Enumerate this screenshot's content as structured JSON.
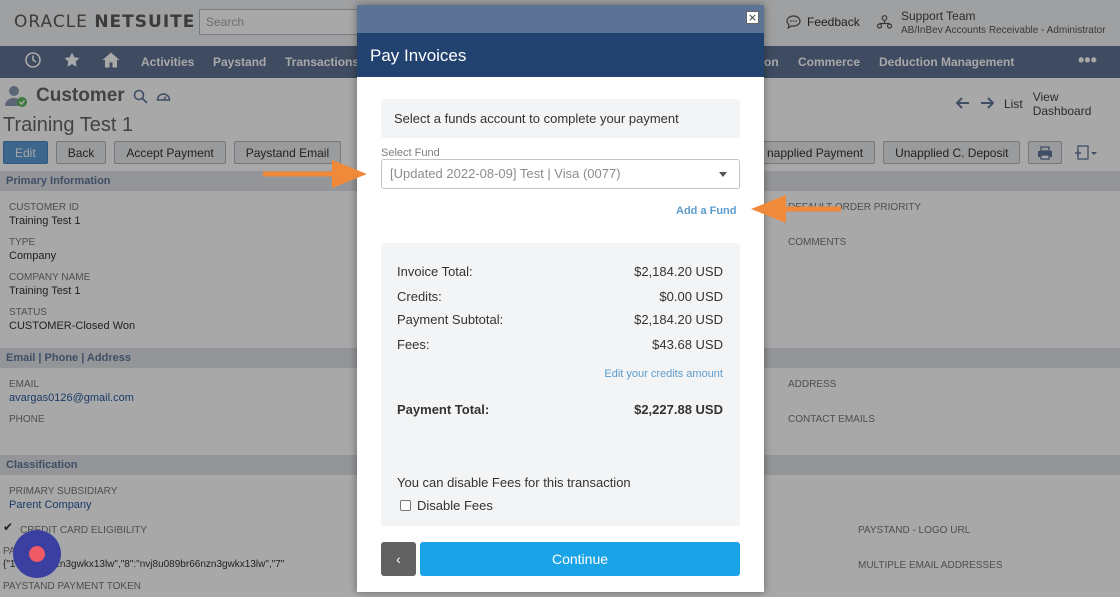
{
  "app": {
    "logo_a": "ORACLE ",
    "logo_b": "NETSUITE",
    "search_placeholder": "Search",
    "feedback": "Feedback",
    "user_name": "Support Team",
    "user_role": "AB/InBev Accounts Receivable - Administrator"
  },
  "nav": {
    "items": [
      "Activities",
      "Paystand",
      "Transactions",
      "on",
      "Commerce",
      "Deduction Management"
    ],
    "more": "•••"
  },
  "page": {
    "type": "Customer",
    "record_name": "Training Test 1",
    "right_links": [
      "List",
      "View Dashboard"
    ]
  },
  "buttons": {
    "edit": "Edit",
    "back": "Back",
    "accept_payment": "Accept Payment",
    "paystand_email": "Paystand Email",
    "unapplied_payment": "napplied Payment",
    "unapplied_deposit": "Unapplied C. Deposit"
  },
  "sections": {
    "primary": "Primary Information",
    "contact": "Email | Phone | Address",
    "classification": "Classification"
  },
  "fields": {
    "customer_id_label": "CUSTOMER ID",
    "customer_id_value": "Training Test 1",
    "type_label": "TYPE",
    "type_value": "Company",
    "company_name_label": "COMPANY NAME",
    "company_name_value": "Training Test 1",
    "status_label": "STATUS",
    "status_value": "CUSTOMER-Closed Won",
    "default_order_priority_label": "DEFAULT ORDER PRIORITY",
    "comments_label": "COMMENTS",
    "email_label": "EMAIL",
    "email_value": "avargas0126@gmail.com",
    "phone_label": "PHONE",
    "address_label": "ADDRESS",
    "contact_emails_label": "CONTACT EMAILS",
    "primary_subsidiary_label": "PRIMARY SUBSIDIARY",
    "primary_subsidiary_value": "Parent Company",
    "credit_card_label": "CREDIT CARD ELIGIBILITY",
    "payerid_label": "PA      PAYERID",
    "payerid_value": "{\"1     89br66nzn3gwkx13lw\",\"8\":\"nvj8u089br66nzn3gwkx13lw\",\"7\"",
    "payment_token_label": "PAYSTAND PAYMENT TOKEN",
    "logo_url_label": "PAYSTAND - LOGO URL",
    "multiple_emails_label": "MULTIPLE EMAIL ADDRESSES"
  },
  "modal": {
    "close": "×",
    "title": "Pay Invoices",
    "notice": "Select a funds account to complete your payment",
    "select_fund_label": "Select Fund",
    "selected_fund": "[Updated 2022-08-09] Test | Visa (0077)",
    "add_fund": "Add a Fund",
    "invoice_total_label": "Invoice Total:",
    "invoice_total_value": "$2,184.20 USD",
    "credits_label": "Credits:",
    "credits_value": "$0.00 USD",
    "payment_subtotal_label": "Payment Subtotal:",
    "payment_subtotal_value": "$2,184.20 USD",
    "fees_label": "Fees:",
    "fees_value": "$43.68 USD",
    "edit_credits": "Edit your credits amount",
    "payment_total_label": "Payment Total:",
    "payment_total_value": "$2,227.88 USD",
    "disable_note": "You can disable Fees for this transaction",
    "disable_fees_label": "Disable Fees",
    "disable_fees_checked": false,
    "back_glyph": "‹",
    "continue": "Continue"
  },
  "colors": {
    "modal_header": "#224270",
    "continue_button": "#1aa3e6",
    "annotation_arrow": "#f0893a",
    "nav_bar": "#5f7392"
  }
}
